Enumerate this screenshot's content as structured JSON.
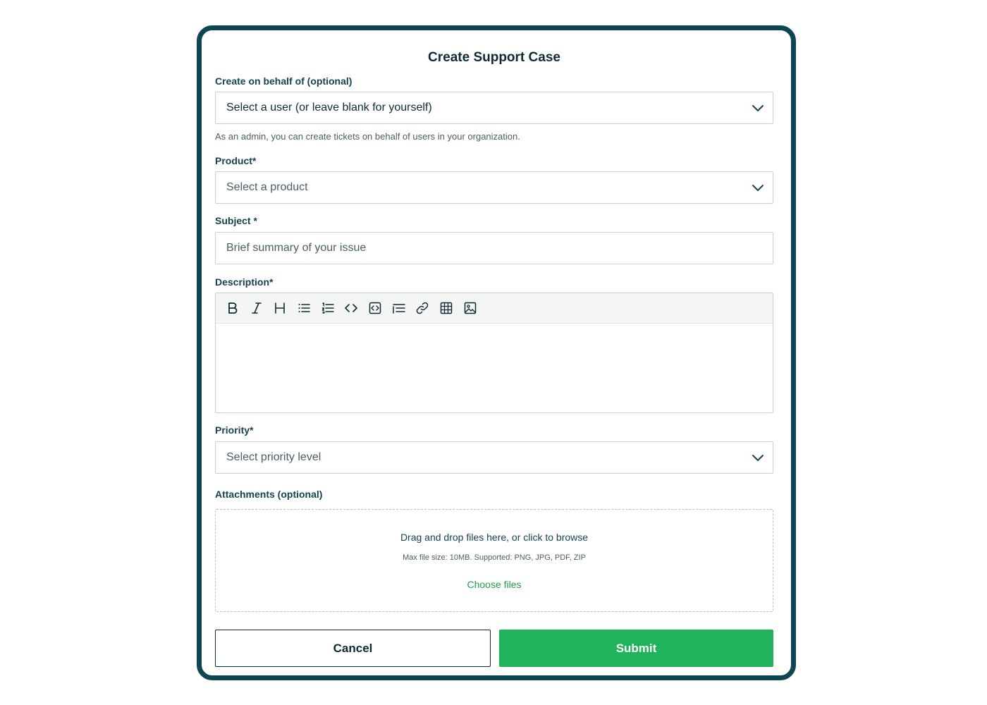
{
  "dialog": {
    "title": "Create Support Case"
  },
  "behalf": {
    "label": "Create on behalf of (optional)",
    "placeholder": "Select a user (or leave blank for yourself)",
    "help": "As an admin, you can create tickets on behalf of users in your organization."
  },
  "product": {
    "label": "Product*",
    "placeholder": "Select a product"
  },
  "subject": {
    "label": "Subject  *",
    "placeholder": "Brief summary of your issue"
  },
  "description": {
    "label": "Description*",
    "toolbar": [
      "bold-icon",
      "italic-icon",
      "heading-icon",
      "bullet-list-icon",
      "numbered-list-icon",
      "inline-code-icon",
      "code-block-icon",
      "indent-icon",
      "link-icon",
      "table-icon",
      "image-icon"
    ]
  },
  "priority": {
    "label": "Priority*",
    "placeholder": "Select priority level"
  },
  "attachments": {
    "label": "Attachments (optional)",
    "drop_text": "Drag and drop files here, or click to browse",
    "limits": "Max file size: 10MB. Supported: PNG, JPG, PDF, ZIP",
    "choose_label": "Choose files"
  },
  "actions": {
    "cancel_label": "Cancel",
    "submit_label": "Submit"
  },
  "colors": {
    "frame": "#0d4650",
    "accent": "#21b35c",
    "link": "#1e9e4a"
  }
}
